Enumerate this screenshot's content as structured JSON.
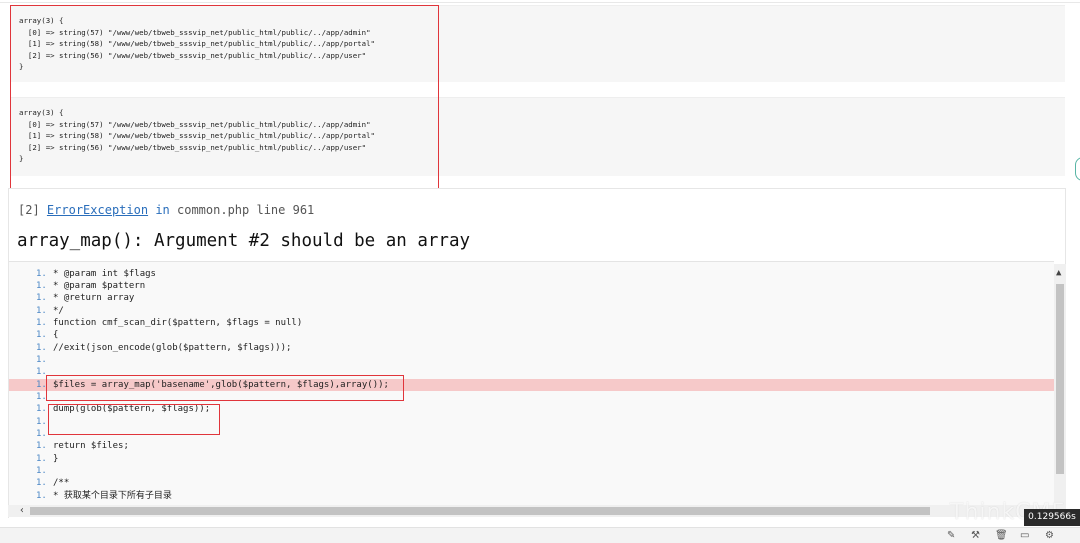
{
  "dumps": [
    {
      "lines": [
        "array(3) {",
        "  [0] => string(57) \"/www/web/tbweb_sssvip_net/public_html/public/../app/admin\"",
        "  [1] => string(58) \"/www/web/tbweb_sssvip_net/public_html/public/../app/portal\"",
        "  [2] => string(56) \"/www/web/tbweb_sssvip_net/public_html/public/../app/user\"",
        "}"
      ]
    },
    {
      "lines": [
        "array(3) {",
        "  [0] => string(57) \"/www/web/tbweb_sssvip_net/public_html/public/../app/admin\"",
        "  [1] => string(58) \"/www/web/tbweb_sssvip_net/public_html/public/../app/portal\"",
        "  [2] => string(56) \"/www/web/tbweb_sssvip_net/public_html/public/../app/user\"",
        "}"
      ]
    }
  ],
  "exception": {
    "index": "[2]",
    "type": "ErrorException",
    "in_word": "in",
    "file_line": "common.php line 961",
    "message": "array_map(): Argument #2 should be an array"
  },
  "source": {
    "rows": [
      {
        "ln": "1.",
        "code": "* @param int $flags"
      },
      {
        "ln": "1.",
        "code": "* @param $pattern"
      },
      {
        "ln": "1.",
        "code": "* @return array"
      },
      {
        "ln": "1.",
        "code": "*/"
      },
      {
        "ln": "1.",
        "code": "function cmf_scan_dir($pattern, $flags = null)"
      },
      {
        "ln": "1.",
        "code": "{"
      },
      {
        "ln": "1.",
        "code": "//exit(json_encode(glob($pattern, $flags)));"
      },
      {
        "ln": "1.",
        "code": ""
      },
      {
        "ln": "1.",
        "code": ""
      },
      {
        "ln": "1.",
        "code": "$files = array_map('basename',glob($pattern, $flags),array());",
        "highlight": true
      },
      {
        "ln": "1.",
        "code": ""
      },
      {
        "ln": "1.",
        "code": "dump(glob($pattern, $flags));"
      },
      {
        "ln": "1.",
        "code": ""
      },
      {
        "ln": "1.",
        "code": ""
      },
      {
        "ln": "1.",
        "code": "return $files;"
      },
      {
        "ln": "1.",
        "code": "}"
      },
      {
        "ln": "1.",
        "code": ""
      },
      {
        "ln": "1.",
        "code": "/**"
      },
      {
        "ln": "1.",
        "code": "* 获取某个目录下所有子目录"
      }
    ]
  },
  "footer": {
    "time": "0.129566s",
    "watermark": "ThinkCMF",
    "icons": [
      "pin-icon",
      "tool-icon",
      "trash-icon",
      "file-icon",
      "gear-icon"
    ]
  },
  "colors": {
    "highlight": "#f6c9c9",
    "annotation_red": "#e0353b",
    "link": "#2a6ebb"
  }
}
